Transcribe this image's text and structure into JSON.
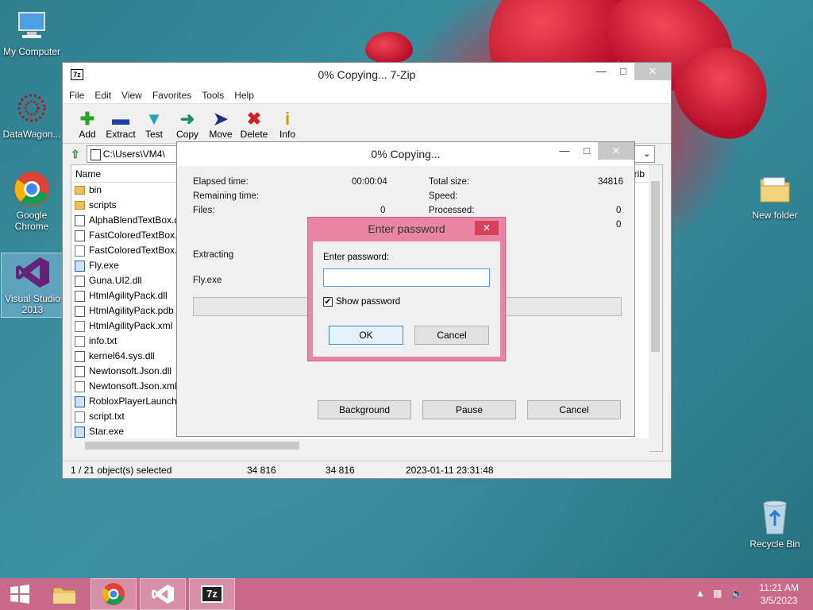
{
  "desktop": {
    "icons": [
      {
        "label": "My Computer"
      },
      {
        "label": "DataWagon..."
      },
      {
        "label": "Google Chrome"
      },
      {
        "label": "Visual Studio 2013"
      },
      {
        "label": "New folder"
      },
      {
        "label": "Recycle Bin"
      }
    ]
  },
  "main_window": {
    "app_icon": "7z",
    "title": "0% Copying... 7-Zip",
    "menu": [
      "File",
      "Edit",
      "View",
      "Favorites",
      "Tools",
      "Help"
    ],
    "toolbar": [
      {
        "label": "Add",
        "icon": "plus-icon",
        "color": "#2aa32a"
      },
      {
        "label": "Extract",
        "icon": "minus-icon",
        "color": "#1f3fa8"
      },
      {
        "label": "Test",
        "icon": "check-icon",
        "color": "#1fa7b8"
      },
      {
        "label": "Copy",
        "icon": "arrow-right-icon",
        "color": "#1a8c6a"
      },
      {
        "label": "Move",
        "icon": "arrow-right-icon",
        "color": "#1f2f88"
      },
      {
        "label": "Delete",
        "icon": "x-icon",
        "color": "#d81f1f"
      },
      {
        "label": "Info",
        "icon": "info-icon",
        "color": "#c8a000"
      }
    ],
    "address": "C:\\Users\\VM4\\",
    "columns": {
      "name": "Name",
      "attrib": "Attrib"
    },
    "files": [
      {
        "name": "bin",
        "type": "folder"
      },
      {
        "name": "scripts",
        "type": "folder"
      },
      {
        "name": "AlphaBlendTextBox.d",
        "type": "dll"
      },
      {
        "name": "FastColoredTextBox.d",
        "type": "dll"
      },
      {
        "name": "FastColoredTextBox.x",
        "type": "file"
      },
      {
        "name": "Fly.exe",
        "type": "exe"
      },
      {
        "name": "Guna.UI2.dll",
        "type": "dll"
      },
      {
        "name": "HtmlAgilityPack.dll",
        "type": "dll"
      },
      {
        "name": "HtmlAgilityPack.pdb",
        "type": "dll"
      },
      {
        "name": "HtmlAgilityPack.xml",
        "type": "file"
      },
      {
        "name": "info.txt",
        "type": "file"
      },
      {
        "name": "kernel64.sys.dll",
        "type": "dll"
      },
      {
        "name": "Newtonsoft.Json.dll",
        "type": "dll"
      },
      {
        "name": "Newtonsoft.Json.xml",
        "type": "file"
      },
      {
        "name": "RobloxPlayerLaunche",
        "type": "exe"
      },
      {
        "name": "script.txt",
        "type": "file"
      },
      {
        "name": "Star.exe",
        "type": "exe"
      }
    ],
    "status": {
      "selected": "1 / 21 object(s) selected",
      "size1": "34 816",
      "size2": "34 816",
      "modified": "2023-01-11 23:31:48"
    }
  },
  "copy_dialog": {
    "title": "0% Copying...",
    "elapsed_label": "Elapsed time:",
    "elapsed_value": "00:00:04",
    "remaining_label": "Remaining time:",
    "files_label": "Files:",
    "files_value": "0",
    "total_size_label": "Total size:",
    "total_size_value": "34816",
    "speed_label": "Speed:",
    "processed_label": "Processed:",
    "processed_value": "0",
    "extra_value": "0",
    "action": "Extracting",
    "current_file": "Fly.exe",
    "progress": 0,
    "buttons": {
      "background": "Background",
      "pause": "Pause",
      "cancel": "Cancel"
    }
  },
  "password_dialog": {
    "title": "Enter password",
    "field_label": "Enter password:",
    "field_value": "",
    "show_password_label": "Show password",
    "show_password_checked": true,
    "ok": "OK",
    "cancel": "Cancel"
  },
  "taskbar": {
    "time": "11:21 AM",
    "date": "3/5/2023",
    "app_7z": "7z"
  }
}
